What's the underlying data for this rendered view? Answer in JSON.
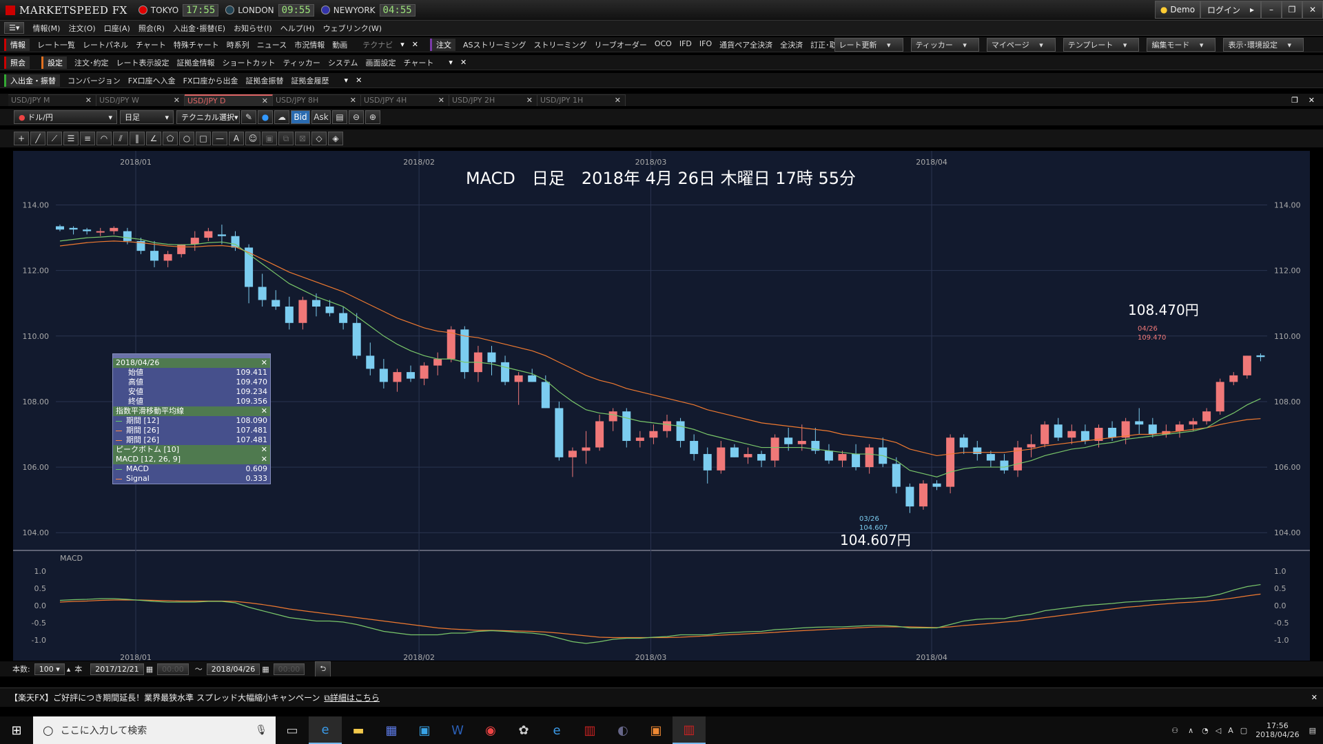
{
  "app": {
    "brand": "MARKETSPEED FX",
    "clocks": [
      {
        "city": "TOKYO",
        "time": "17:55",
        "flag": "#d00"
      },
      {
        "city": "LONDON",
        "time": "09:55",
        "flag": "#245"
      },
      {
        "city": "NEWYORK",
        "time": "04:55",
        "flag": "#33a"
      }
    ],
    "demo": "Demo",
    "login": "ログイン"
  },
  "menu": [
    "情報(M)",
    "注文(O)",
    "口座(A)",
    "照会(R)",
    "入出金･振替(E)",
    "お知らせ(I)",
    "ヘルプ(H)",
    "ウェブリンク(W)"
  ],
  "toolbar1": {
    "label": "情報",
    "items": [
      "レート一覧",
      "レートパネル",
      "チャート",
      "特殊チャート",
      "時系列",
      "ニュース",
      "市況情報",
      "動画"
    ],
    "dim": "テクナビ",
    "label2": "注文",
    "items2": [
      "ASストリーミング",
      "ストリーミング",
      "リーブオーダー",
      "OCO",
      "IFD",
      "IFO",
      "通貨ペア全決済",
      "全決済",
      "訂正･取消"
    ],
    "right": [
      "レート更新",
      "ティッカー",
      "マイページ",
      "テンプレート",
      "編集モード",
      "表示･環境設定"
    ]
  },
  "toolbar2": {
    "label": "照会",
    "label2": "設定",
    "items": [
      "注文･約定",
      "レート表示設定",
      "証拠金情報",
      "ショートカット",
      "ティッカー",
      "システム",
      "画面設定",
      "チャート"
    ]
  },
  "toolbar3": {
    "label": "入出金・振替",
    "items": [
      "コンバージョン",
      "FX口座へ入金",
      "FX口座から出金",
      "証拠金振替",
      "証拠金履歴"
    ]
  },
  "tabs": [
    {
      "label": "USD/JPY M",
      "active": false
    },
    {
      "label": "USD/JPY W",
      "active": false
    },
    {
      "label": "USD/JPY D",
      "active": true
    },
    {
      "label": "USD/JPY 8H",
      "active": false
    },
    {
      "label": "USD/JPY 4H",
      "active": false
    },
    {
      "label": "USD/JPY 2H",
      "active": false
    },
    {
      "label": "USD/JPY 1H",
      "active": false
    }
  ],
  "controls": {
    "pair": "ドル/円",
    "period": "日足",
    "tech": "テクニカル選択",
    "bid": "Bid",
    "ask": "Ask"
  },
  "overlay": {
    "title": "MACD　日足　2018年 4月 26日 木曜日 17時 55分",
    "high_label": "108.470円",
    "high_date": "04/26",
    "high_val": "109.470",
    "low_label": "104.607円",
    "low_date": "03/26",
    "low_val": "104.607"
  },
  "infobox": {
    "date": "2018/04/26",
    "ohlc": [
      [
        "始値",
        "109.411"
      ],
      [
        "高値",
        "109.470"
      ],
      [
        "安値",
        "109.234"
      ],
      [
        "終値",
        "109.356"
      ]
    ],
    "ema_title": "指数平滑移動平均線",
    "ema": [
      [
        "期間 [12]",
        "108.090",
        "#6c6"
      ],
      [
        "期間 [26]",
        "107.481",
        "#f84"
      ],
      [
        "期間 [26]",
        "107.481",
        "#f84"
      ]
    ],
    "peak": "ピークボトム [10]",
    "macd_title": "MACD [12, 26, 9]",
    "macd": [
      [
        "MACD",
        "0.609",
        "#6c6"
      ],
      [
        "Signal",
        "0.333",
        "#f84"
      ]
    ]
  },
  "footer": {
    "count_label": "本数:",
    "count": "100",
    "unit": "本",
    "from": "2017/12/21",
    "to": "2018/04/26",
    "time_ph": "00:00",
    "tilde": "～"
  },
  "banner": {
    "text": "【楽天FX】ご好評につき期間延長！業界最狭水準 スプレッド大幅縮小キャンペーン",
    "link": "詳細はこちら"
  },
  "taskbar": {
    "search": "ここに入力して検索",
    "time": "17:56",
    "date": "2018/04/26"
  },
  "chart_data": {
    "type": "candlestick",
    "title": "MACD　日足",
    "x_ticks": [
      "2018/01",
      "2018/02",
      "2018/03",
      "2018/04"
    ],
    "y_ticks": [
      "114.00",
      "112.00",
      "110.00",
      "108.00",
      "106.00",
      "104.00"
    ],
    "ylim": [
      103.5,
      114.6
    ],
    "macd_ticks": [
      "1.0",
      "0.5",
      "0.0",
      "-0.5",
      "-1.0"
    ],
    "macd_lim": [
      -1.2,
      1.2
    ],
    "macd_label": "MACD",
    "candles": [
      [
        113.35,
        113.4,
        113.2,
        113.25
      ],
      [
        113.3,
        113.35,
        113.1,
        113.25
      ],
      [
        113.25,
        113.3,
        113.1,
        113.2
      ],
      [
        113.2,
        113.3,
        113.05,
        113.2
      ],
      [
        113.2,
        113.35,
        113.1,
        113.3
      ],
      [
        113.2,
        113.3,
        112.8,
        112.9
      ],
      [
        112.9,
        113.0,
        112.5,
        112.6
      ],
      [
        112.6,
        112.9,
        112.1,
        112.3
      ],
      [
        112.3,
        112.6,
        112.1,
        112.5
      ],
      [
        112.5,
        112.8,
        112.4,
        112.8
      ],
      [
        112.8,
        113.2,
        112.6,
        113.0
      ],
      [
        113.0,
        113.3,
        112.9,
        113.2
      ],
      [
        113.1,
        113.4,
        112.8,
        113.05
      ],
      [
        113.05,
        113.2,
        112.6,
        112.7
      ],
      [
        112.7,
        112.8,
        111.0,
        111.5
      ],
      [
        111.5,
        111.9,
        110.9,
        111.1
      ],
      [
        111.1,
        111.4,
        110.8,
        110.9
      ],
      [
        110.9,
        111.2,
        110.2,
        110.4
      ],
      [
        110.4,
        111.2,
        110.2,
        111.1
      ],
      [
        111.1,
        111.3,
        110.6,
        110.9
      ],
      [
        110.9,
        111.1,
        110.6,
        110.7
      ],
      [
        110.7,
        110.9,
        110.2,
        110.4
      ],
      [
        110.4,
        110.7,
        109.3,
        109.4
      ],
      [
        109.4,
        109.8,
        108.8,
        109.0
      ],
      [
        109.0,
        109.3,
        108.4,
        108.6
      ],
      [
        108.6,
        109.0,
        108.3,
        108.9
      ],
      [
        108.9,
        109.1,
        108.6,
        108.7
      ],
      [
        108.7,
        109.2,
        108.5,
        109.1
      ],
      [
        109.1,
        109.5,
        108.8,
        109.3
      ],
      [
        109.3,
        110.3,
        109.2,
        110.2
      ],
      [
        110.2,
        110.3,
        108.7,
        108.9
      ],
      [
        108.9,
        109.7,
        108.6,
        109.5
      ],
      [
        109.5,
        109.7,
        108.8,
        109.2
      ],
      [
        109.2,
        109.4,
        108.5,
        108.6
      ],
      [
        108.6,
        108.9,
        107.9,
        108.8
      ],
      [
        108.8,
        109.0,
        108.6,
        108.6
      ],
      [
        108.6,
        108.8,
        107.8,
        107.8
      ],
      [
        107.8,
        108.0,
        106.2,
        106.3
      ],
      [
        106.3,
        106.6,
        105.7,
        106.5
      ],
      [
        106.5,
        107.1,
        106.1,
        106.6
      ],
      [
        106.6,
        107.6,
        106.5,
        107.4
      ],
      [
        107.4,
        107.8,
        107.1,
        107.7
      ],
      [
        107.7,
        107.8,
        106.6,
        106.8
      ],
      [
        106.8,
        107.1,
        106.6,
        106.9
      ],
      [
        106.9,
        107.3,
        106.7,
        107.1
      ],
      [
        107.1,
        107.6,
        106.9,
        107.4
      ],
      [
        107.4,
        107.5,
        106.6,
        106.8
      ],
      [
        106.8,
        107.0,
        106.2,
        106.4
      ],
      [
        106.4,
        106.6,
        105.5,
        105.9
      ],
      [
        105.9,
        106.8,
        105.8,
        106.6
      ],
      [
        106.6,
        106.7,
        106.3,
        106.3
      ],
      [
        106.3,
        106.6,
        106.1,
        106.4
      ],
      [
        106.4,
        106.5,
        106.0,
        106.2
      ],
      [
        106.2,
        107.0,
        106.0,
        106.9
      ],
      [
        106.9,
        107.2,
        106.5,
        106.7
      ],
      [
        106.7,
        107.3,
        106.5,
        106.8
      ],
      [
        106.8,
        107.2,
        106.4,
        106.5
      ],
      [
        106.5,
        106.7,
        106.1,
        106.2
      ],
      [
        106.2,
        106.5,
        106.0,
        106.4
      ],
      [
        106.4,
        106.7,
        105.9,
        106.0
      ],
      [
        106.0,
        106.7,
        105.8,
        106.6
      ],
      [
        106.6,
        106.9,
        106.0,
        106.1
      ],
      [
        106.1,
        106.3,
        105.2,
        105.4
      ],
      [
        105.4,
        105.5,
        104.6,
        104.8
      ],
      [
        104.8,
        105.6,
        104.7,
        105.5
      ],
      [
        105.5,
        105.6,
        105.3,
        105.4
      ],
      [
        105.4,
        107.0,
        105.2,
        106.9
      ],
      [
        106.9,
        107.0,
        106.4,
        106.6
      ],
      [
        106.6,
        106.8,
        106.2,
        106.4
      ],
      [
        106.4,
        106.5,
        106.0,
        106.2
      ],
      [
        106.2,
        106.4,
        105.8,
        105.9
      ],
      [
        105.9,
        106.8,
        105.7,
        106.6
      ],
      [
        106.6,
        107.0,
        106.3,
        106.7
      ],
      [
        106.7,
        107.4,
        106.6,
        107.3
      ],
      [
        107.3,
        107.5,
        106.8,
        106.9
      ],
      [
        106.9,
        107.3,
        106.7,
        107.1
      ],
      [
        107.1,
        107.3,
        106.7,
        106.8
      ],
      [
        106.8,
        107.3,
        106.6,
        107.2
      ],
      [
        107.2,
        107.4,
        106.8,
        106.9
      ],
      [
        106.9,
        107.5,
        106.7,
        107.4
      ],
      [
        107.4,
        107.8,
        107.0,
        107.3
      ],
      [
        107.3,
        107.5,
        106.9,
        107.0
      ],
      [
        107.0,
        107.3,
        106.9,
        107.1
      ],
      [
        107.1,
        107.4,
        106.9,
        107.3
      ],
      [
        107.3,
        107.5,
        107.1,
        107.4
      ],
      [
        107.4,
        107.8,
        107.3,
        107.7
      ],
      [
        107.7,
        108.7,
        107.6,
        108.6
      ],
      [
        108.6,
        108.9,
        108.5,
        108.8
      ],
      [
        108.8,
        109.4,
        108.7,
        109.4
      ],
      [
        109.41,
        109.47,
        109.23,
        109.36
      ]
    ],
    "ema12": [
      112.9,
      112.95,
      113.0,
      113.02,
      113.05,
      113.0,
      112.95,
      112.85,
      112.8,
      112.78,
      112.8,
      112.85,
      112.87,
      112.8,
      112.5,
      112.2,
      111.9,
      111.6,
      111.4,
      111.2,
      111.05,
      110.9,
      110.6,
      110.3,
      110.0,
      109.75,
      109.55,
      109.4,
      109.3,
      109.3,
      109.2,
      109.2,
      109.15,
      109.05,
      108.95,
      108.85,
      108.65,
      108.3,
      108.0,
      107.75,
      107.65,
      107.6,
      107.5,
      107.4,
      107.35,
      107.3,
      107.25,
      107.15,
      107.0,
      106.9,
      106.8,
      106.7,
      106.6,
      106.6,
      106.6,
      106.6,
      106.55,
      106.5,
      106.45,
      106.4,
      106.4,
      106.35,
      106.2,
      105.9,
      105.8,
      105.7,
      105.85,
      105.95,
      106.0,
      106.0,
      106.0,
      106.1,
      106.2,
      106.35,
      106.45,
      106.55,
      106.6,
      106.7,
      106.75,
      106.85,
      106.9,
      106.95,
      107.0,
      107.05,
      107.1,
      107.2,
      107.45,
      107.65,
      107.9,
      108.09
    ],
    "ema26": [
      112.75,
      112.8,
      112.85,
      112.88,
      112.9,
      112.88,
      112.85,
      112.8,
      112.75,
      112.72,
      112.72,
      112.75,
      112.76,
      112.72,
      112.55,
      112.35,
      112.15,
      111.95,
      111.8,
      111.65,
      111.5,
      111.35,
      111.15,
      110.95,
      110.75,
      110.55,
      110.4,
      110.25,
      110.15,
      110.1,
      110.0,
      109.95,
      109.85,
      109.75,
      109.65,
      109.55,
      109.4,
      109.2,
      109.0,
      108.8,
      108.65,
      108.55,
      108.4,
      108.3,
      108.2,
      108.1,
      108.0,
      107.9,
      107.75,
      107.65,
      107.55,
      107.45,
      107.35,
      107.3,
      107.25,
      107.2,
      107.15,
      107.1,
      107.0,
      106.95,
      106.9,
      106.85,
      106.75,
      106.55,
      106.45,
      106.35,
      106.4,
      106.45,
      106.45,
      106.45,
      106.45,
      106.5,
      106.55,
      106.65,
      106.7,
      106.75,
      106.8,
      106.85,
      106.9,
      106.95,
      107.0,
      107.0,
      107.05,
      107.1,
      107.15,
      107.2,
      107.3,
      107.38,
      107.45,
      107.48
    ],
    "macd": [
      0.15,
      0.17,
      0.18,
      0.2,
      0.2,
      0.18,
      0.15,
      0.12,
      0.1,
      0.1,
      0.1,
      0.12,
      0.12,
      0.08,
      -0.05,
      -0.15,
      -0.25,
      -0.35,
      -0.4,
      -0.45,
      -0.45,
      -0.48,
      -0.55,
      -0.65,
      -0.75,
      -0.8,
      -0.85,
      -0.85,
      -0.85,
      -0.8,
      -0.8,
      -0.75,
      -0.73,
      -0.75,
      -0.78,
      -0.8,
      -0.85,
      -0.95,
      -1.05,
      -1.1,
      -1.05,
      -0.98,
      -0.95,
      -0.95,
      -0.92,
      -0.9,
      -0.85,
      -0.85,
      -0.85,
      -0.8,
      -0.78,
      -0.76,
      -0.75,
      -0.7,
      -0.68,
      -0.65,
      -0.63,
      -0.62,
      -0.62,
      -0.6,
      -0.58,
      -0.58,
      -0.6,
      -0.65,
      -0.65,
      -0.65,
      -0.55,
      -0.45,
      -0.4,
      -0.38,
      -0.38,
      -0.3,
      -0.25,
      -0.15,
      -0.1,
      -0.05,
      0.0,
      0.03,
      0.06,
      0.1,
      0.12,
      0.15,
      0.17,
      0.2,
      0.22,
      0.25,
      0.33,
      0.45,
      0.55,
      0.609
    ],
    "signal": [
      0.1,
      0.12,
      0.13,
      0.15,
      0.16,
      0.16,
      0.16,
      0.15,
      0.14,
      0.13,
      0.13,
      0.13,
      0.13,
      0.12,
      0.08,
      0.03,
      -0.03,
      -0.1,
      -0.15,
      -0.2,
      -0.25,
      -0.3,
      -0.35,
      -0.4,
      -0.45,
      -0.5,
      -0.55,
      -0.6,
      -0.65,
      -0.68,
      -0.7,
      -0.72,
      -0.72,
      -0.73,
      -0.74,
      -0.75,
      -0.77,
      -0.8,
      -0.84,
      -0.88,
      -0.92,
      -0.93,
      -0.93,
      -0.93,
      -0.93,
      -0.93,
      -0.92,
      -0.9,
      -0.88,
      -0.86,
      -0.84,
      -0.82,
      -0.8,
      -0.78,
      -0.75,
      -0.73,
      -0.71,
      -0.69,
      -0.67,
      -0.65,
      -0.63,
      -0.62,
      -0.62,
      -0.62,
      -0.63,
      -0.64,
      -0.62,
      -0.58,
      -0.55,
      -0.52,
      -0.48,
      -0.45,
      -0.4,
      -0.35,
      -0.3,
      -0.25,
      -0.2,
      -0.15,
      -0.1,
      -0.05,
      -0.02,
      0.02,
      0.05,
      0.08,
      0.1,
      0.13,
      0.17,
      0.22,
      0.28,
      0.333
    ]
  }
}
